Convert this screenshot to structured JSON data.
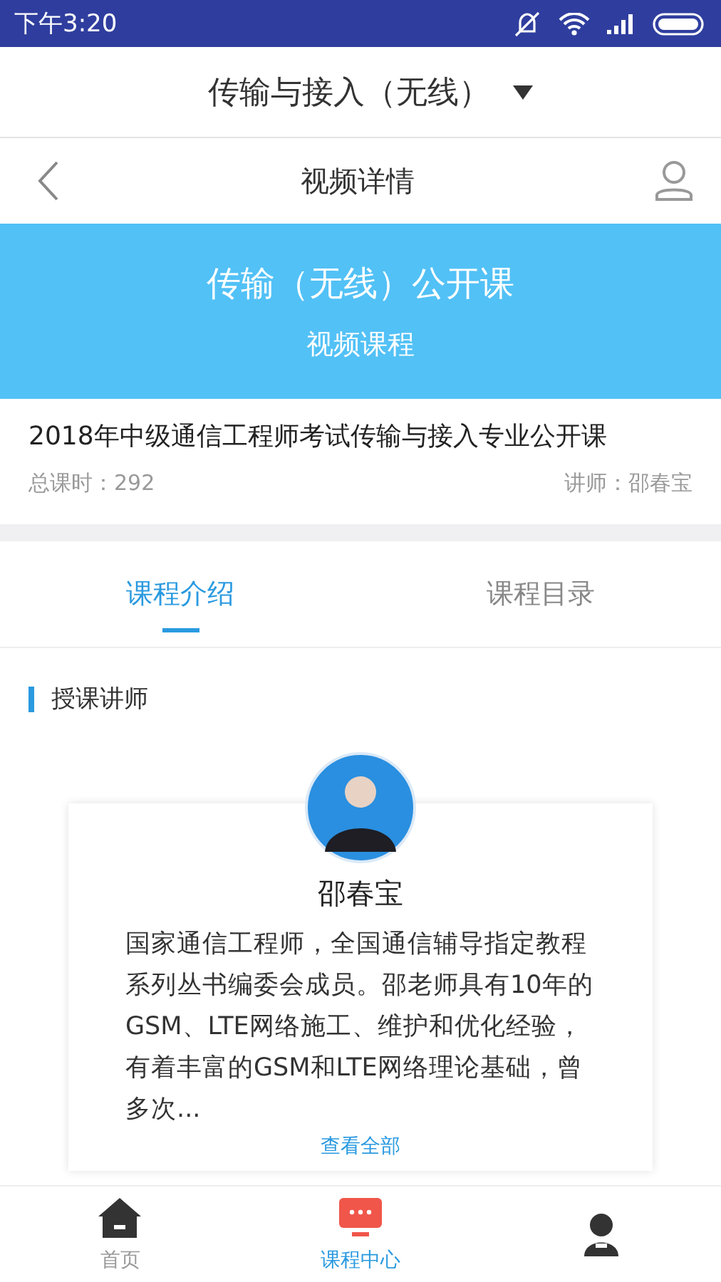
{
  "status_bar": {
    "time": "下午3:20"
  },
  "category_selector": {
    "label": "传输与接入（无线）"
  },
  "nav_bar": {
    "title": "视频详情"
  },
  "banner": {
    "title": "传输（无线）公开课",
    "subtitle": "视频课程"
  },
  "course": {
    "title": "2018年中级通信工程师考试传输与接入专业公开课",
    "hours": "总课时：292",
    "teacher": "讲师：邵春宝"
  },
  "tabs": [
    {
      "label": "课程介绍",
      "selected": true
    },
    {
      "label": "课程目录",
      "selected": false
    }
  ],
  "section": {
    "heading": "授课讲师"
  },
  "teacher_card": {
    "name": "邵春宝",
    "bio": "国家通信工程师，全国通信辅导指定教程系列丛书编委会成员。邵老师具有10年的GSM、LTE网络施工、维护和优化经验，有着丰富的GSM和LTE网络理论基础，曾多次...",
    "link": "查看全部"
  },
  "bottom_nav": [
    {
      "kind": "home",
      "label": "首页",
      "selected": false
    },
    {
      "kind": "courses",
      "label": "课程中心",
      "selected": true
    },
    {
      "kind": "profile",
      "selected": false
    }
  ]
}
